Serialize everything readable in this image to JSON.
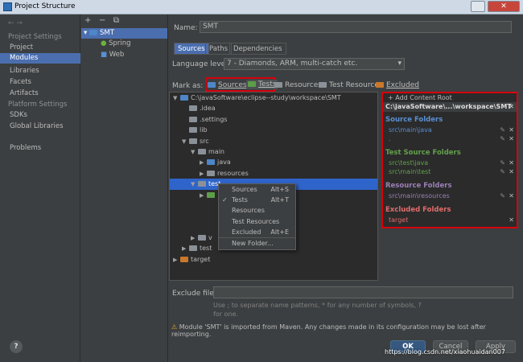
{
  "window": {
    "title": "Project Structure"
  },
  "left_nav": {
    "project_settings_header": "Project Settings",
    "project_settings": [
      "Project",
      "Modules",
      "Libraries",
      "Facets",
      "Artifacts"
    ],
    "platform_settings_header": "Platform Settings",
    "platform_settings": [
      "SDKs",
      "Global Libraries"
    ],
    "problems": "Problems",
    "selected": "Modules"
  },
  "module_tree": {
    "root": "SMT",
    "children": [
      "Spring",
      "Web"
    ]
  },
  "form": {
    "name_label": "Name:",
    "name_value": "SMT",
    "tabs": [
      "Sources",
      "Paths",
      "Dependencies"
    ],
    "active_tab": "Sources",
    "language_level_label": "Language level:",
    "language_level_value": "7 - Diamonds, ARM, multi-catch etc."
  },
  "mark_as": {
    "label": "Mark as:",
    "options": [
      "Sources",
      "Tests",
      "Resources",
      "Test Resources",
      "Excluded"
    ]
  },
  "file_tree": [
    {
      "label": "C:\\javaSoftware\\eclipse--study\\workspace\\SMT",
      "level": 0,
      "arrow": "▼",
      "color": "blue"
    },
    {
      "label": ".idea",
      "level": 1,
      "arrow": "",
      "color": "grey"
    },
    {
      "label": ".settings",
      "level": 1,
      "arrow": "",
      "color": "grey"
    },
    {
      "label": "lib",
      "level": 1,
      "arrow": "",
      "color": "grey"
    },
    {
      "label": "src",
      "level": 1,
      "arrow": "▼",
      "color": "grey"
    },
    {
      "label": "main",
      "level": 2,
      "arrow": "▼",
      "color": "grey"
    },
    {
      "label": "java",
      "level": 3,
      "arrow": "▶",
      "color": "blue"
    },
    {
      "label": "resources",
      "level": 3,
      "arrow": "▶",
      "color": "grey"
    },
    {
      "label": "test",
      "level": 2,
      "arrow": "▼",
      "color": "grey"
    },
    {
      "label": "",
      "level": 3,
      "arrow": "▶",
      "color": "green"
    },
    {
      "label": "",
      "level": 3,
      "arrow": "",
      "color": ""
    },
    {
      "label": "",
      "level": 3,
      "arrow": "",
      "color": ""
    },
    {
      "label": "",
      "level": 3,
      "arrow": "",
      "color": ""
    },
    {
      "label": "v",
      "level": 2,
      "arrow": "▶",
      "color": "grey"
    },
    {
      "label": "test",
      "level": 1,
      "arrow": "▶",
      "color": "grey"
    },
    {
      "label": "target",
      "level": 0,
      "arrow": "▶",
      "color": "orange"
    }
  ],
  "context_menu": [
    {
      "label": "Sources",
      "shortcut": "Alt+S",
      "checked": false
    },
    {
      "label": "Tests",
      "shortcut": "Alt+T",
      "checked": true
    },
    {
      "label": "Resources",
      "shortcut": "",
      "checked": false
    },
    {
      "label": "Test Resources",
      "shortcut": "",
      "checked": false
    },
    {
      "label": "Excluded",
      "shortcut": "Alt+E",
      "checked": false
    },
    {
      "label": "New Folder...",
      "shortcut": "",
      "checked": false
    }
  ],
  "content_root": {
    "add_label": "+ Add Content Root",
    "path": "C:\\javaSoftware\\...\\workspace\\SMT",
    "source_header": "Source Folders",
    "source_items": [
      "src\\main\\java",
      "."
    ],
    "test_header": "Test Source Folders",
    "test_items": [
      "src\\test\\java",
      "src\\main\\test"
    ],
    "resource_header": "Resource Folders",
    "resource_items": [
      "src\\main\\resources"
    ],
    "excluded_header": "Excluded Folders",
    "excluded_items": [
      "target"
    ]
  },
  "exclude": {
    "label": "Exclude files:",
    "hint": "Use ; to separate name patterns, * for any number of symbols, ? for one."
  },
  "warning": "Module 'SMT' is imported from Maven. Any changes made in its configuration may be lost after reimporting.",
  "buttons": {
    "ok": "OK",
    "cancel": "Cancel",
    "apply": "Apply",
    "help": "?"
  },
  "watermark": "https://blog.csdn.net/xiaohuaidan007",
  "colors": {
    "source": "#5a8fd1",
    "test": "#62a04c",
    "resource": "#9b7fb6",
    "excluded": "#e06c6c",
    "highlight": "#d6000c"
  }
}
